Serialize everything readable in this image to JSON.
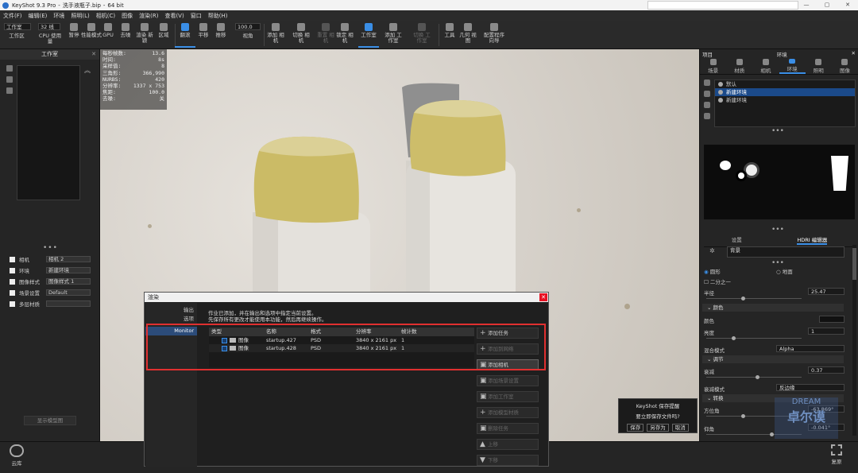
{
  "title_bar": {
    "app": "KeyShot 9.3 Pro",
    "file": "洗手液瓶子.bip",
    "arch": "64 bit"
  },
  "menu": [
    "文件(F)",
    "编辑(E)",
    "环境",
    "照明(L)",
    "相机(C)",
    "图像",
    "渲染(R)",
    "查看(V)",
    "窗口",
    "帮助(H)"
  ],
  "toolbar": {
    "workspace_select": "工作室",
    "cpu_value": "32 线",
    "zoom_value": "100.0",
    "items": [
      {
        "label": "工作区",
        "name": "workspace"
      },
      {
        "label": "CPU 使用量",
        "name": "cpu-usage"
      },
      {
        "label": "暂停",
        "name": "pause"
      },
      {
        "label": "性能模式",
        "name": "performance-mode"
      },
      {
        "label": "GPU",
        "name": "gpu"
      },
      {
        "label": "去噪",
        "name": "denoise"
      },
      {
        "label": "渲染 新颖",
        "name": "render-region"
      },
      {
        "label": "区域",
        "name": "region"
      },
      {
        "label": "翻滚",
        "name": "tumble"
      },
      {
        "label": "平移",
        "name": "pan"
      },
      {
        "label": "推移",
        "name": "dolly"
      },
      {
        "label": "视角",
        "name": "view-angle"
      },
      {
        "label": "添加 相机",
        "name": "add-camera"
      },
      {
        "label": "切换 相机",
        "name": "switch-camera"
      },
      {
        "label": "重置 相机",
        "name": "reset-camera"
      },
      {
        "label": "锁定 相机",
        "name": "lock-camera"
      },
      {
        "label": "工作室",
        "name": "studio"
      },
      {
        "label": "添加 工作室",
        "name": "add-studio"
      },
      {
        "label": "切换 工作室",
        "name": "switch-studio"
      },
      {
        "label": "工具",
        "name": "tools"
      },
      {
        "label": "几何 视图",
        "name": "geometry-view"
      },
      {
        "label": "配置程序 向导",
        "name": "configurator-wizard"
      }
    ]
  },
  "left_panel": {
    "title": "工作室",
    "rows": [
      {
        "label": "相机",
        "value": "相机 2"
      },
      {
        "label": "环境",
        "value": "新建环境"
      },
      {
        "label": "图像样式",
        "value": "图像样式 1"
      },
      {
        "label": "场景设置",
        "value": "Default"
      },
      {
        "label": "多层材质",
        "value": ""
      }
    ],
    "bottom_button": "显示模型图"
  },
  "stats": [
    {
      "k": "每秒帧数:",
      "v": "13.6"
    },
    {
      "k": "时间:",
      "v": "8s"
    },
    {
      "k": "采样值:",
      "v": "8"
    },
    {
      "k": "三角形:",
      "v": "366,990"
    },
    {
      "k": "NURBS:",
      "v": "420"
    },
    {
      "k": "分辨率:",
      "v": "1337 x 753"
    },
    {
      "k": "焦距:",
      "v": "100.0"
    },
    {
      "k": "去噪:",
      "v": "关"
    }
  ],
  "right_panel": {
    "project_label": "项目",
    "title": "环境",
    "tabs": [
      {
        "label": "场景",
        "active": false
      },
      {
        "label": "材质",
        "active": false
      },
      {
        "label": "相机",
        "active": false
      },
      {
        "label": "环境",
        "active": true
      },
      {
        "label": "照明",
        "active": false
      },
      {
        "label": "图像",
        "active": false
      }
    ],
    "environments": [
      {
        "label": "默认",
        "selected": false
      },
      {
        "label": "新建环境",
        "selected": true
      },
      {
        "label": "新建环境",
        "selected": false
      }
    ],
    "subtabs": [
      {
        "label": "设置",
        "active": false
      },
      {
        "label": "HDRI 编辑器",
        "active": true
      }
    ],
    "background_field": "背景",
    "shadow_option": "圆形",
    "ground_option": "地面",
    "half_label": "二分之一",
    "radius_label": "半径",
    "radius_value": "25.47",
    "color_section": "颜色",
    "color_label": "颜色",
    "color_swatch": "#111111",
    "brightness_label": "亮度",
    "brightness_value": "1",
    "blend_label": "混合模式",
    "blend_value": "Alpha",
    "adjust_section": "调节",
    "falloff_label": "衰减",
    "falloff_value": "0.37",
    "falloff_mode_label": "衰减模式",
    "falloff_mode_value": "反边缘",
    "transform_section": "转换",
    "azimuth_label": "方位角",
    "azimuth_value": "-63.869°",
    "elevation_label": "仰角",
    "elevation_value": "-0.041°"
  },
  "render_dialog": {
    "title": "渲染",
    "nav": [
      "输出",
      "选项",
      "Monitor"
    ],
    "message_line1": "作业已添加，并在输出和选项中指定当前设置。",
    "message_line2": "先保存所有更改才能使用本功能，然后再继续操作。",
    "columns": [
      "类型",
      "名称",
      "格式",
      "分辨率",
      "帧计数"
    ],
    "rows": [
      {
        "type": "图像",
        "name": "startup.427",
        "format": "PSD",
        "resolution": "3840 x 2161 px",
        "frames": "1"
      },
      {
        "type": "图像",
        "name": "startup.428",
        "format": "PSD",
        "resolution": "3840 x 2161 px",
        "frames": "1"
      }
    ],
    "buttons": [
      {
        "label": "添加任务",
        "enabled": true,
        "icon": "+"
      },
      {
        "label": "添加到网络",
        "enabled": false,
        "icon": "+"
      },
      {
        "label": "添加相机",
        "enabled": true,
        "icon": "▣"
      },
      {
        "label": "添加场景设置",
        "enabled": false,
        "icon": "▣"
      },
      {
        "label": "添加工作室",
        "enabled": false,
        "icon": "▣"
      },
      {
        "label": "添加模型材质",
        "enabled": false,
        "icon": "+"
      },
      {
        "label": "删除任务",
        "enabled": false,
        "icon": "▣"
      },
      {
        "label": "上移",
        "enabled": false,
        "icon": "▲"
      },
      {
        "label": "下移",
        "enabled": false,
        "icon": "▼"
      }
    ]
  },
  "save_reminder": {
    "title": "KeyShot 保存提醒",
    "message": "要立即保存文件吗?",
    "buttons": [
      "保存",
      "另存为",
      "取消"
    ]
  },
  "statusbar": {
    "cloud_label": "云库",
    "resume_label": "复原"
  },
  "watermark": {
    "line1": "DREAM",
    "line2": "卓尔谟"
  }
}
